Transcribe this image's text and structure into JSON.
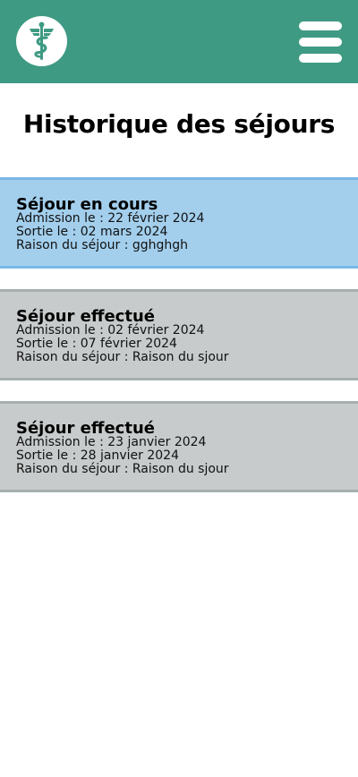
{
  "header": {
    "logo_icon": "caduceus-icon",
    "menu_icon": "hamburger-menu-icon",
    "background_color": "#3f9a83"
  },
  "page": {
    "title": "Historique des séjours"
  },
  "stays": [
    {
      "status": "current",
      "title": "Séjour en cours",
      "admission": "Admission le : 22 février 2024",
      "sortie": "Sortie le : 02 mars 2024",
      "raison": "Raison du séjour : gghghgh",
      "background_color": "#a3cfed"
    },
    {
      "status": "done",
      "title": "Séjour effectué",
      "admission": "Admission le : 02 février 2024",
      "sortie": "Sortie le : 07 février 2024",
      "raison": "Raison du séjour : Raison du sjour",
      "background_color": "#c7cbcb"
    },
    {
      "status": "done",
      "title": "Séjour effectué",
      "admission": "Admission le : 23 janvier 2024",
      "sortie": "Sortie le : 28 janvier 2024",
      "raison": "Raison du séjour : Raison du sjour",
      "background_color": "#c7cbcb"
    }
  ]
}
